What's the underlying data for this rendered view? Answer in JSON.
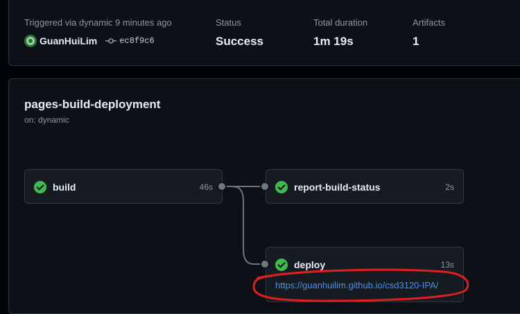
{
  "summary": {
    "trigger_text": "Triggered via dynamic 9 minutes ago",
    "actor": "GuanHuiLim",
    "commit": "ec8f9c6",
    "status_label": "Status",
    "status_value": "Success",
    "duration_label": "Total duration",
    "duration_value": "1m 19s",
    "artifacts_label": "Artifacts",
    "artifacts_value": "1"
  },
  "workflow": {
    "name": "pages-build-deployment",
    "trigger": "on: dynamic",
    "jobs": [
      {
        "name": "build",
        "duration": "46s",
        "status": "success"
      },
      {
        "name": "report-build-status",
        "duration": "2s",
        "status": "success"
      },
      {
        "name": "deploy",
        "duration": "13s",
        "status": "success",
        "url": "https://guanhuilim.github.io/csd3120-IPA/"
      }
    ]
  },
  "colors": {
    "success": "#3fb950",
    "link": "#4493f8",
    "annotation": "#e02020"
  }
}
